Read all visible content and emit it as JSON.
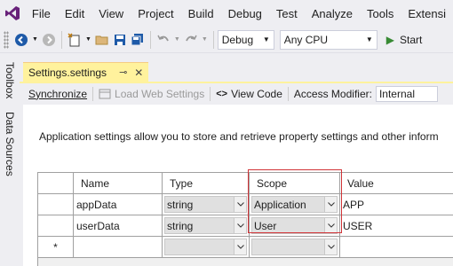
{
  "menu": {
    "items": [
      {
        "id": "file",
        "label": "File"
      },
      {
        "id": "edit",
        "label": "Edit"
      },
      {
        "id": "view",
        "label": "View"
      },
      {
        "id": "project",
        "label": "Project"
      },
      {
        "id": "build",
        "label": "Build"
      },
      {
        "id": "debug",
        "label": "Debug"
      },
      {
        "id": "test",
        "label": "Test"
      },
      {
        "id": "analyze",
        "label": "Analyze"
      },
      {
        "id": "tools",
        "label": "Tools"
      },
      {
        "id": "extensions",
        "label": "Extensi"
      }
    ]
  },
  "toolbar": {
    "configuration": "Debug",
    "platform": "Any CPU",
    "start_label": "Start"
  },
  "side_tools": {
    "toolbox": "Toolbox",
    "data_sources": "Data Sources"
  },
  "document_tab": {
    "title": "Settings.settings",
    "pin_glyph": "⊸",
    "close_glyph": "✕"
  },
  "designer_toolbar": {
    "synchronize": "Synchronize",
    "load_web_settings": "Load Web Settings",
    "view_code": "View Code",
    "access_modifier_label": "Access Modifier:",
    "access_modifier_value": "Internal"
  },
  "description": "Application settings allow you to store and retrieve property settings and other inform",
  "grid": {
    "headers": {
      "name": "Name",
      "type": "Type",
      "scope": "Scope",
      "value": "Value"
    },
    "rows": [
      {
        "name": "appData",
        "type": "string",
        "scope": "Application",
        "value": "APP"
      },
      {
        "name": "userData",
        "type": "string",
        "scope": "User",
        "value": "USER"
      }
    ],
    "new_row_marker": "*"
  },
  "colors": {
    "accent": "#68217a",
    "tab_active": "#fff29d",
    "highlight_border": "#d13438",
    "start_green": "#388a34"
  }
}
